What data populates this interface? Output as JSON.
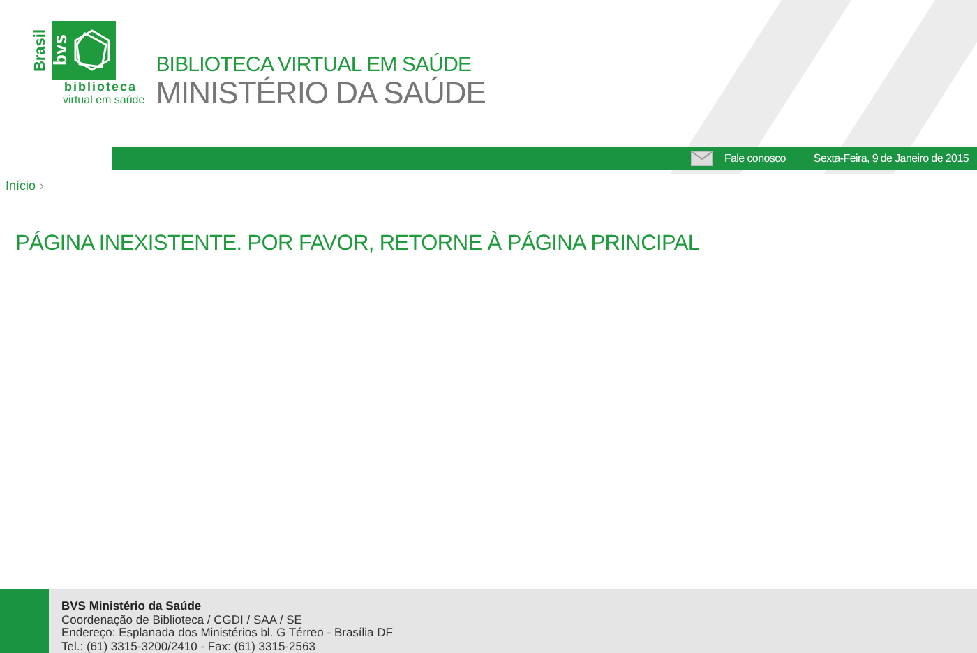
{
  "logo": {
    "country": "Brasil",
    "mark": "bvs",
    "line_1": "biblioteca",
    "line_2": "virtual em saúde"
  },
  "header": {
    "title": "BIBLIOTECA VIRTUAL EM SAÚDE",
    "subtitle": "MINISTÉRIO DA SAÚDE"
  },
  "top_bar": {
    "contact_link": "Fale conosco",
    "date": "Sexta-Feira, 9 de Janeiro de 2015"
  },
  "breadcrumb": {
    "items": [
      "Início"
    ],
    "separator": "›"
  },
  "message": "PÁGINA INEXISTENTE. POR FAVOR, RETORNE À PÁGINA PRINCIPAL",
  "footer": {
    "lines": [
      {
        "text": "BVS Ministério da Saúde",
        "kind": "heading"
      },
      {
        "text": "Coordenação de Biblioteca / CGDI / SAA / SE",
        "kind": "plain"
      },
      {
        "text": "Endereço: Esplanada dos Ministérios bl. G Térreo - Brasília DF",
        "kind": "plain"
      },
      {
        "text": "Tel.: (61) 3315-3200/2410 - Fax: (61) 3315-2563",
        "kind": "plain"
      }
    ]
  }
}
